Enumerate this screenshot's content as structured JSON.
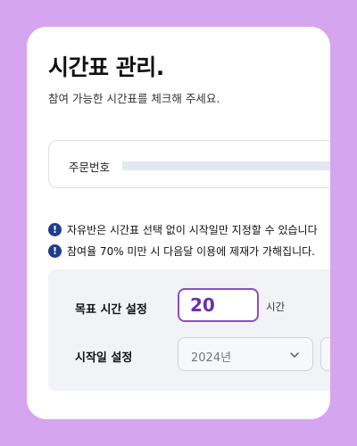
{
  "header": {
    "title": "시간표 관리.",
    "subtitle": "참여 가능한 시간표를 체크해 주세요."
  },
  "order": {
    "label": "주문번호"
  },
  "notices": [
    {
      "icon": "info-icon",
      "text": "자유반은 시간표 선택 없이 시작일만 지정할 수 있습니다"
    },
    {
      "icon": "info-icon",
      "text": "참여율 70% 미만 시 다음달 이용에 제재가 가해집니다."
    }
  ],
  "settings": {
    "goal_label": "목표 시간 설정",
    "goal_value": "20",
    "goal_unit": "시간",
    "start_label": "시작일 설정",
    "year_select": "2024년",
    "month_select": ""
  },
  "colors": {
    "background": "#d6a5ef",
    "accent": "#8c4ec6",
    "info_icon": "#1f3d8f",
    "panel": "#f1f3f7"
  }
}
